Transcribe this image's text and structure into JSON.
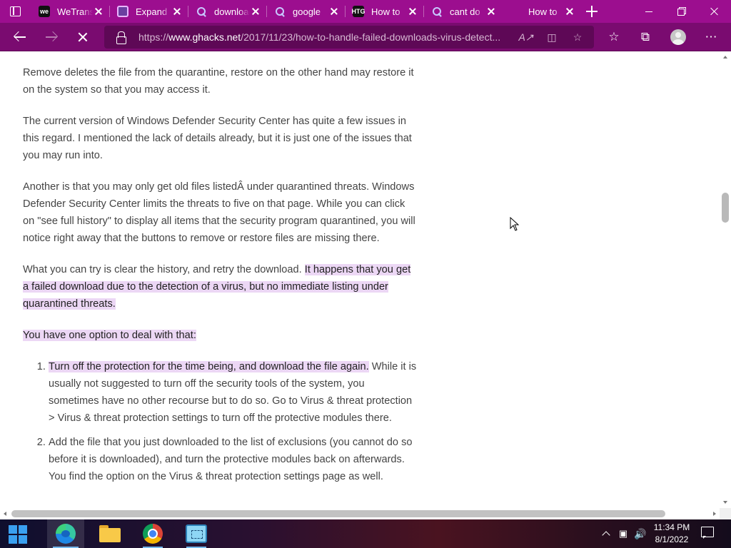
{
  "browser": {
    "tabs": [
      {
        "title": "WeTransfer",
        "favicon": "wetransfer-icon"
      },
      {
        "title": "Expand",
        "favicon": "expand-site-icon"
      },
      {
        "title": "download",
        "favicon": "search-icon"
      },
      {
        "title": "google",
        "favicon": "search-icon"
      },
      {
        "title": "How to",
        "favicon": "htg-icon"
      },
      {
        "title": "cant do",
        "favicon": "search-icon"
      },
      {
        "title": "How to",
        "favicon": "ghacks-icon",
        "active": true
      }
    ],
    "address": {
      "prefix": "https://",
      "host": "www.ghacks.net",
      "path": "/2017/11/23/how-to-handle-failed-downloads-virus-detect..."
    },
    "theme_color": "#9c0e8f"
  },
  "article": {
    "p1": "Remove deletes the file from the quarantine, restore on the other hand may restore it on the system so that you may access it.",
    "p2": "The current version of Windows Defender Security Center has quite a few issues in this regard. I mentioned the lack of details already, but it is just one of the issues that you may run into.",
    "p3": "Another is that you may only get old files listedÂ  under quarantined threats. Windows Defender Security Center limits the threats to five on that page. While you can click on \"see full history\" to display all items that the security program quarantined, you will notice right away that the buttons to remove or restore files are missing there.",
    "p4_plain": "What you can try is clear the history, and retry the download. ",
    "p4_highlight": "It happens that you get a failed download due to the detection of a virus, but no immediate listing under quarantined threats.",
    "p5_highlight": "You have one option to deal with that:",
    "list": [
      {
        "highlight": "Turn off the protection for the time being, and download the file again.",
        "rest": " While it is usually not suggested to turn off the security tools of the system, you sometimes have no other recourse but to do so. Go to Virus & threat protection > Virus & threat protection settings to turn off the protective modules there."
      },
      {
        "highlight": "",
        "rest": "Add the file that you just downloaded to the list of exclusions (you cannot do so before it is downloaded), and turn the protective modules back on afterwards. You find the option on the Virus & threat protection settings page as well."
      }
    ],
    "highlight_color": "#ecd7f5"
  },
  "taskbar": {
    "apps": [
      "edge-icon",
      "file-explorer-icon",
      "chrome-icon",
      "snipping-tool-icon"
    ],
    "time": "11:34 PM",
    "date": "8/1/2022"
  }
}
